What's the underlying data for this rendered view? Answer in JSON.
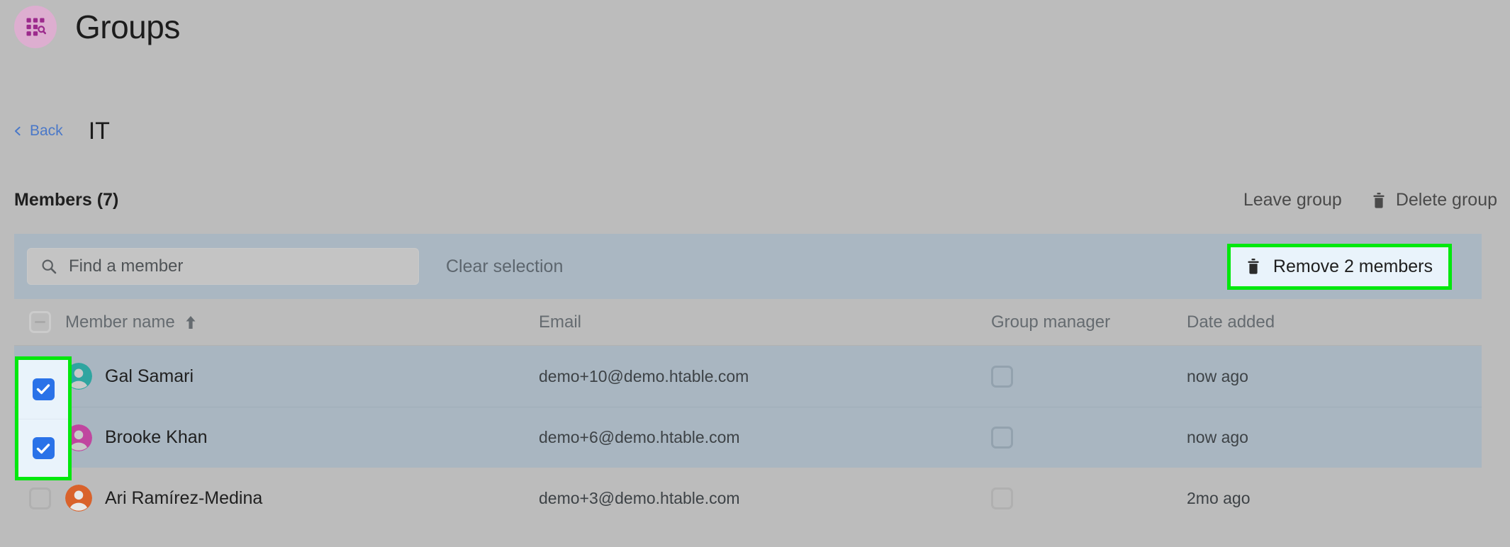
{
  "header": {
    "logo_icon": "grid-search-icon",
    "title": "Groups",
    "logo_bg": "#ddaed0",
    "logo_fg": "#9c2a8c"
  },
  "breadcrumb": {
    "back_label": "Back",
    "back_icon": "chevron-left-icon",
    "group_name": "IT",
    "link_color": "#4a78c8"
  },
  "members_bar": {
    "count_label": "Members (7)",
    "leave_group_label": "Leave group",
    "delete_group_label": "Delete group",
    "delete_icon": "trash-icon"
  },
  "toolbar": {
    "search_icon": "search-icon",
    "search_value": "",
    "search_placeholder": "Find a member",
    "clear_selection_label": "Clear selection",
    "remove_label": "Remove 2 members",
    "remove_icon": "trash-icon",
    "highlight_color": "#00e80d",
    "background": "#aab7c2"
  },
  "table": {
    "select_all_state": "indeterminate",
    "columns": [
      {
        "key": "name",
        "label": "Member name",
        "sort": "asc",
        "sort_icon": "arrow-up-icon"
      },
      {
        "key": "email",
        "label": "Email"
      },
      {
        "key": "manager",
        "label": "Group manager"
      },
      {
        "key": "date",
        "label": "Date added"
      }
    ],
    "rows": [
      {
        "selected": true,
        "avatar_color": "#2fa5a0",
        "name": "Gal Samari",
        "email": "demo+10@demo.htable.com",
        "group_manager": false,
        "date_added": "now ago"
      },
      {
        "selected": true,
        "avatar_color": "#c0469f",
        "name": "Brooke Khan",
        "email": "demo+6@demo.htable.com",
        "group_manager": false,
        "date_added": "now ago"
      },
      {
        "selected": false,
        "avatar_color": "#d9622b",
        "name": "Ari Ramírez-Medina",
        "email": "demo+3@demo.htable.com",
        "group_manager": false,
        "date_added": "2mo ago"
      }
    ]
  }
}
